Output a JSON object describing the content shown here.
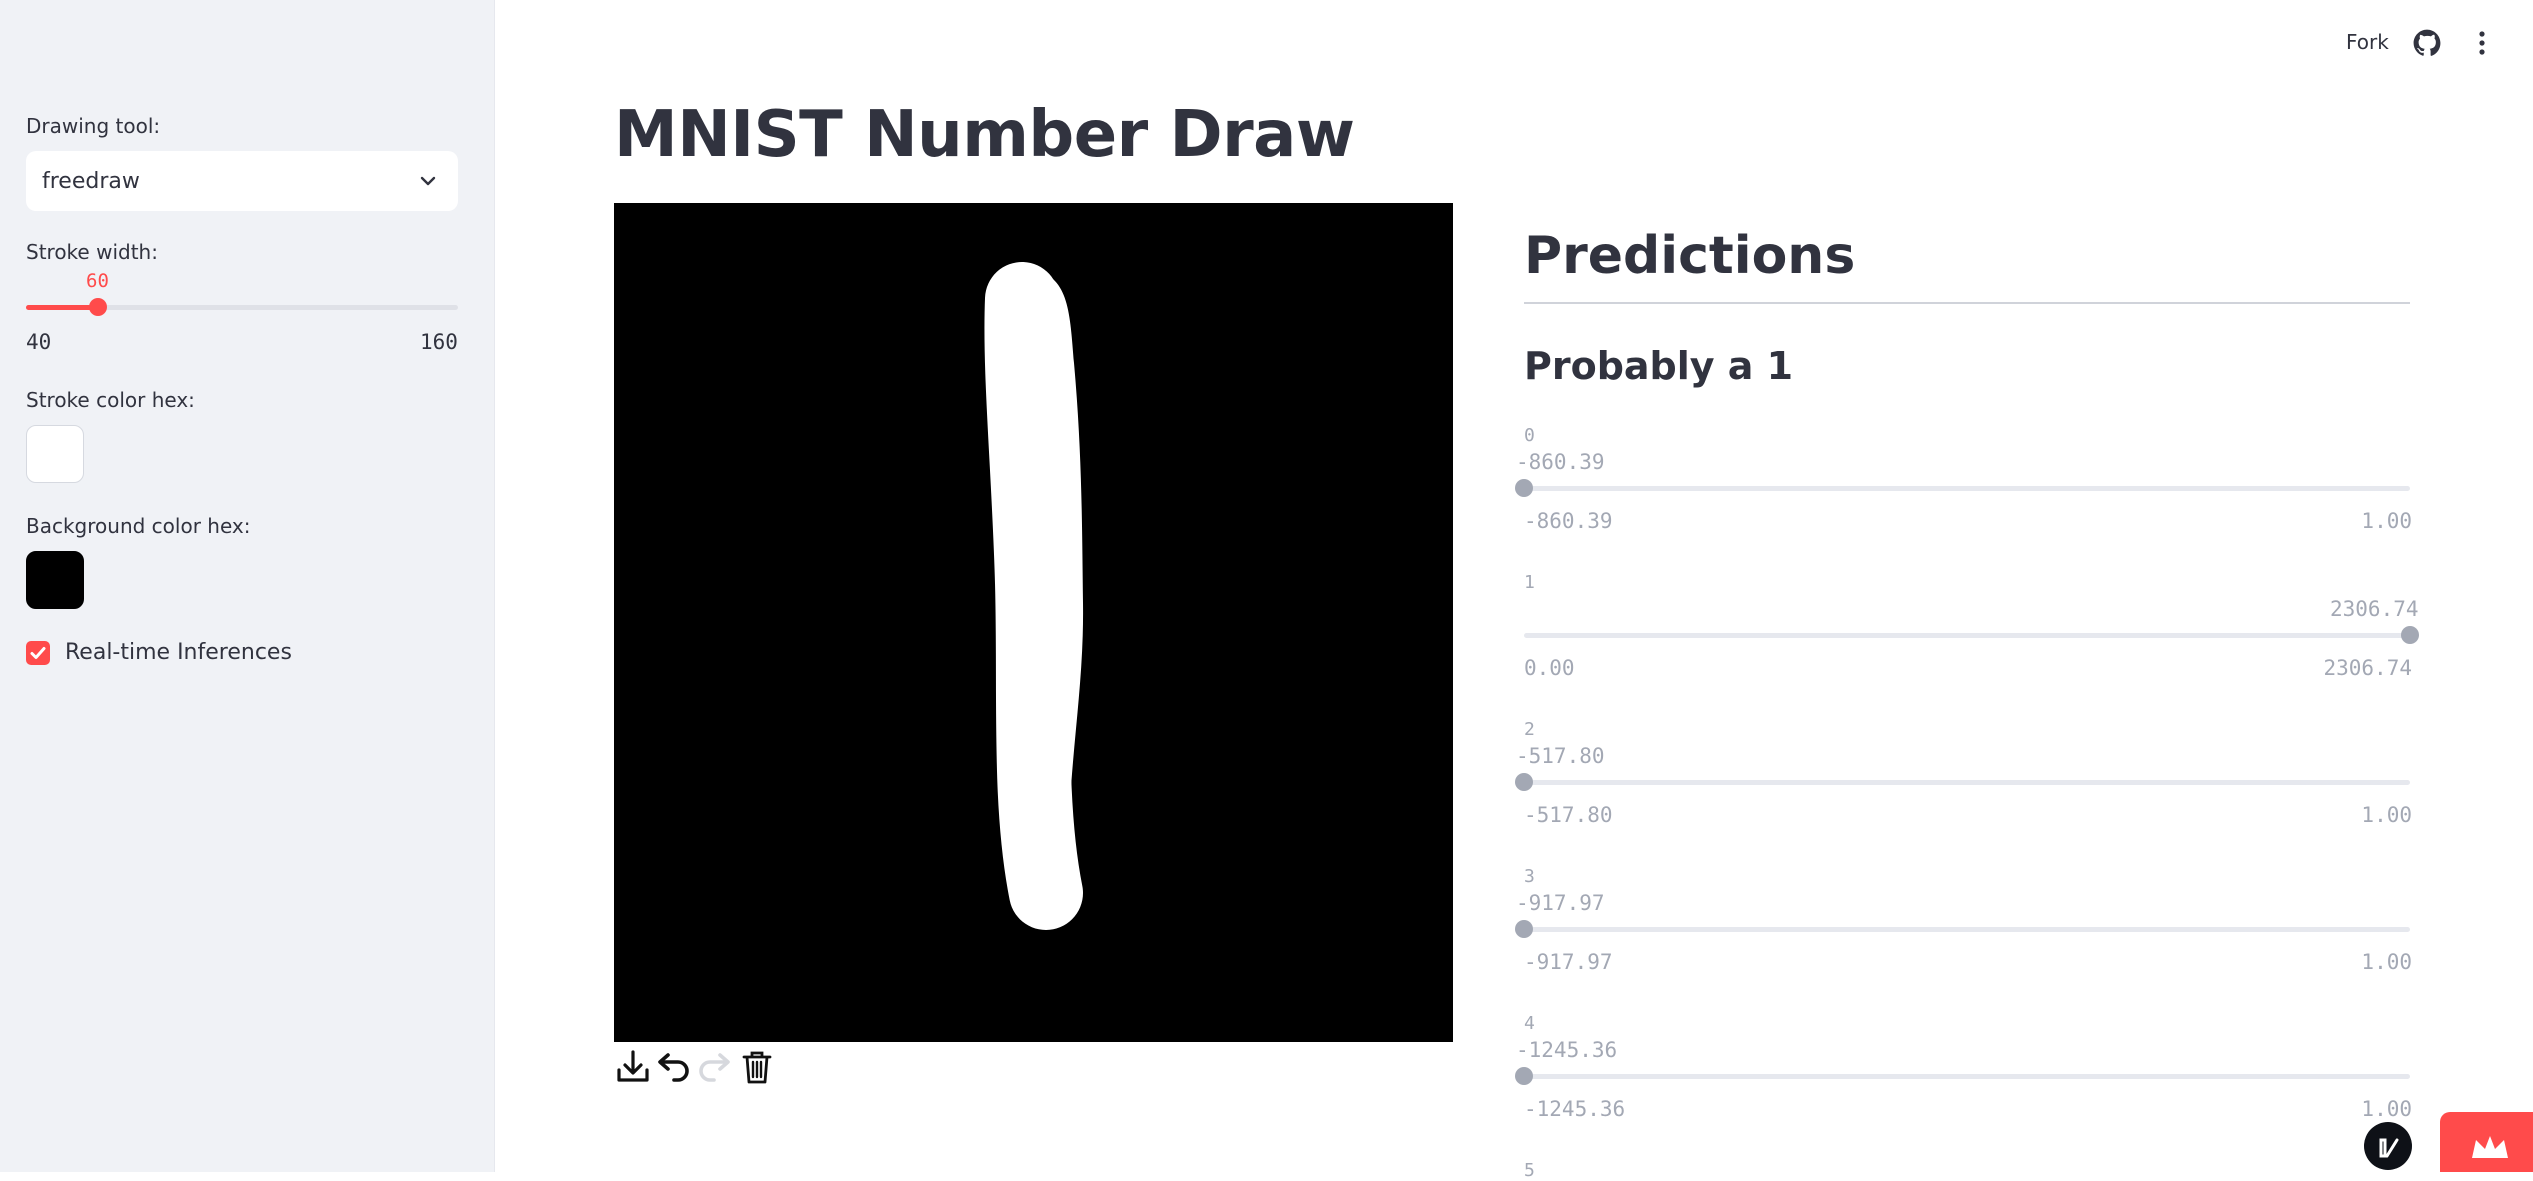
{
  "sidebar": {
    "drawing_tool_label": "Drawing tool:",
    "drawing_tool_value": "freedraw",
    "stroke_width_label": "Stroke width:",
    "stroke_width_value": "60",
    "stroke_width_min": "40",
    "stroke_width_max": "160",
    "stroke_width_fraction": 0.167,
    "stroke_color_label": "Stroke color hex:",
    "stroke_color": "#ffffff",
    "bg_color_label": "Background color hex:",
    "bg_color": "#000000",
    "realtime_label": "Real-time Inferences",
    "realtime_checked": true
  },
  "header": {
    "fork_label": "Fork",
    "github_icon": "github-icon",
    "menu_icon": "kebab-menu-icon"
  },
  "main": {
    "title": "MNIST Number Draw",
    "toolbar": [
      "download-icon",
      "undo-icon",
      "redo-icon",
      "trash-icon"
    ]
  },
  "predictions": {
    "heading": "Predictions",
    "subheading": "Probably a 1",
    "sliders": [
      {
        "label": "0",
        "value": "-860.39",
        "min": "-860.39",
        "max": "1.00",
        "fraction": 0.0
      },
      {
        "label": "1",
        "value": "2306.74",
        "min": "0.00",
        "max": "2306.74",
        "fraction": 1.0
      },
      {
        "label": "2",
        "value": "-517.80",
        "min": "-517.80",
        "max": "1.00",
        "fraction": 0.0
      },
      {
        "label": "3",
        "value": "-917.97",
        "min": "-917.97",
        "max": "1.00",
        "fraction": 0.0
      },
      {
        "label": "4",
        "value": "-1245.36",
        "min": "-1245.36",
        "max": "1.00",
        "fraction": 0.0
      },
      {
        "label": "5"
      }
    ]
  },
  "colors": {
    "accent": "#ff4b4b",
    "sidebar_bg": "#f0f2f6",
    "text": "#31333f",
    "muted": "#a3a8b4"
  }
}
